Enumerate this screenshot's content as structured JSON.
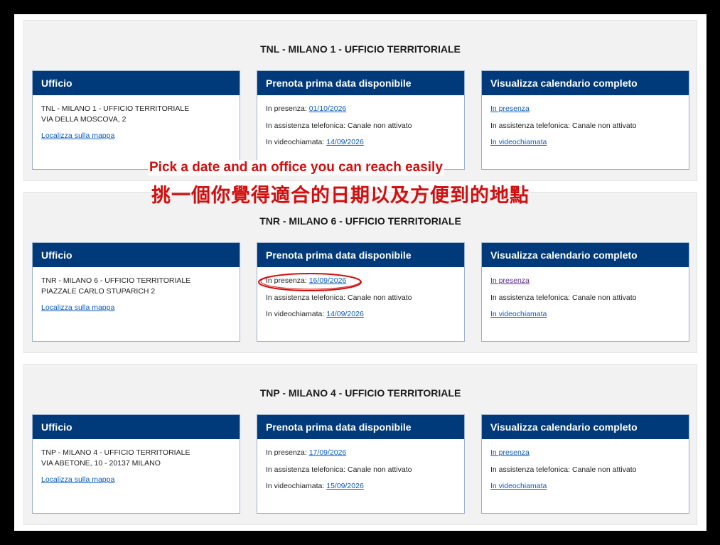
{
  "annotations": {
    "english": "Pick a date and an office you can reach easily",
    "chinese": "挑一個你覺得適合的日期以及方便到的地點"
  },
  "offices": [
    {
      "title": "TNL - MILANO 1 - UFFICIO TERRITORIALE",
      "ufficio": {
        "heading": "Ufficio",
        "name": "TNL - MILANO 1 - UFFICIO TERRITORIALE",
        "address": "VIA DELLA MOSCOVA, 2",
        "map_link": "Localizza sulla mappa"
      },
      "prenota": {
        "heading": "Prenota prima data disponibile",
        "presenza_label": "In presenza:",
        "presenza_date": "01/10/2026",
        "telefonica": "In assistenza telefonica: Canale non attivato",
        "video_label": "In videochiamata:",
        "video_date": "14/09/2026"
      },
      "calendario": {
        "heading": "Visualizza calendario completo",
        "presenza_link": "In presenza",
        "telefonica": "In assistenza telefonica: Canale non attivato",
        "video_link": "In videochiamata"
      }
    },
    {
      "title": "TNR - MILANO 6 - UFFICIO TERRITORIALE",
      "ufficio": {
        "heading": "Ufficio",
        "name": "TNR - MILANO 6 - UFFICIO TERRITORIALE",
        "address": "PIAZZALE CARLO STUPARICH 2",
        "map_link": "Localizza sulla mappa"
      },
      "prenota": {
        "heading": "Prenota prima data disponibile",
        "presenza_label": "In presenza:",
        "presenza_date": "16/09/2026",
        "telefonica": "In assistenza telefonica: Canale non attivato",
        "video_label": "In videochiamata:",
        "video_date": "14/09/2026"
      },
      "calendario": {
        "heading": "Visualizza calendario completo",
        "presenza_link": "In presenza",
        "telefonica": "In assistenza telefonica: Canale non attivato",
        "video_link": "In videochiamata"
      }
    },
    {
      "title": "TNP - MILANO 4 - UFFICIO TERRITORIALE",
      "ufficio": {
        "heading": "Ufficio",
        "name": "TNP - MILANO 4 - UFFICIO TERRITORIALE",
        "address": "VIA ABETONE, 10 - 20137 MILANO",
        "map_link": "Localizza sulla mappa"
      },
      "prenota": {
        "heading": "Prenota prima data disponibile",
        "presenza_label": "In presenza:",
        "presenza_date": "17/09/2026",
        "telefonica": "In assistenza telefonica: Canale non attivato",
        "video_label": "In videochiamata:",
        "video_date": "15/09/2026"
      },
      "calendario": {
        "heading": "Visualizza calendario completo",
        "presenza_link": "In presenza",
        "telefonica": "In assistenza telefonica: Canale non attivato",
        "video_link": "In videochiamata"
      }
    }
  ],
  "colors": {
    "card_header": "#003a7a",
    "link": "#0a5cbe",
    "visited_link": "#5c2d91",
    "annotation": "#d30e0e"
  }
}
